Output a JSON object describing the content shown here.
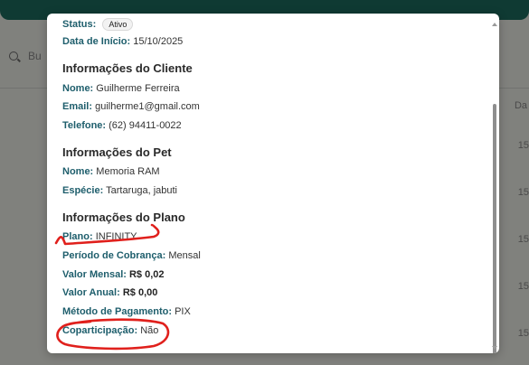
{
  "background": {
    "search_placeholder": "Bu",
    "column_header": "Da",
    "column_values": [
      "15",
      "15",
      "15",
      "15",
      "15"
    ]
  },
  "modal": {
    "status": {
      "label": "Status:",
      "value": "Ativo"
    },
    "data_inicio": {
      "label": "Data de Início:",
      "value": "15/10/2025"
    },
    "cliente": {
      "title": "Informações do Cliente",
      "nome": {
        "label": "Nome:",
        "value": "Guilherme Ferreira"
      },
      "email": {
        "label": "Email:",
        "value": "guilherme1@gmail.com"
      },
      "telefone": {
        "label": "Telefone:",
        "value": "(62) 94411-0022"
      }
    },
    "pet": {
      "title": "Informações do Pet",
      "nome": {
        "label": "Nome:",
        "value": "Memoria RAM"
      },
      "especie": {
        "label": "Espécie:",
        "value": "Tartaruga, jabuti"
      }
    },
    "plano": {
      "title": "Informações do Plano",
      "plano": {
        "label": "Plano:",
        "value": "INFINITY"
      },
      "periodo": {
        "label": "Período de Cobrança:",
        "value": "Mensal"
      },
      "valor_mensal": {
        "label": "Valor Mensal:",
        "value": "R$ 0,02"
      },
      "valor_anual": {
        "label": "Valor Anual:",
        "value": "R$ 0,00"
      },
      "metodo": {
        "label": "Método de Pagamento:",
        "value": "PIX"
      },
      "coparticipacao": {
        "label": "Coparticipação:",
        "value": "Não"
      }
    }
  },
  "colors": {
    "header": "#0f3a33",
    "label": "#1e5e6c",
    "annotation": "#e0201c"
  }
}
